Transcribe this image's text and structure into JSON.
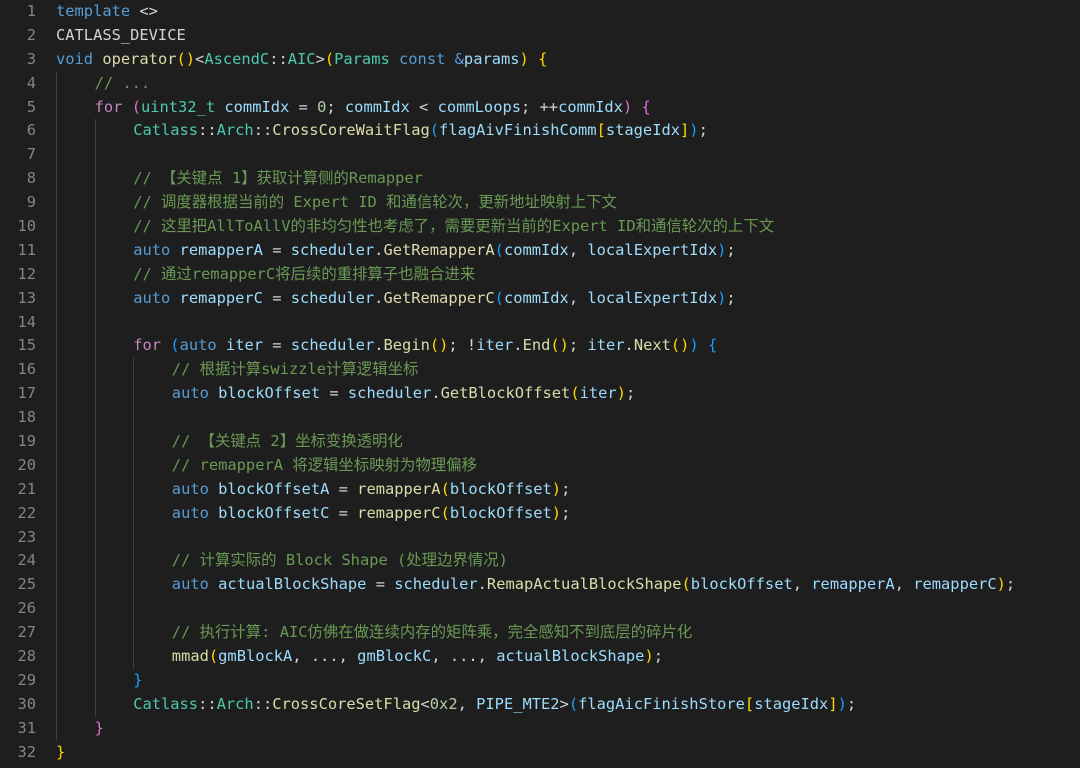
{
  "editor": {
    "theme_colors": {
      "background": "#1e1e1e",
      "line_number": "#858585",
      "keyword": "#569cd6",
      "control": "#c586c0",
      "type": "#4ec9b0",
      "function": "#dcdcaa",
      "variable": "#9cdcfe",
      "number": "#b5cea8",
      "comment": "#6a9955",
      "text": "#d4d4d4",
      "bracket_1": "#ffd700",
      "bracket_2": "#da70d6",
      "bracket_3": "#179fff"
    },
    "lines": [
      {
        "n": "1",
        "indent": 0,
        "tokens": [
          [
            "kw",
            "template"
          ],
          [
            "pl",
            " <>"
          ]
        ]
      },
      {
        "n": "2",
        "indent": 0,
        "tokens": [
          [
            "pl",
            "CATLASS_DEVICE"
          ]
        ]
      },
      {
        "n": "3",
        "indent": 0,
        "tokens": [
          [
            "kw",
            "void"
          ],
          [
            "pl",
            " "
          ],
          [
            "fn",
            "operator"
          ],
          [
            "b1",
            "()"
          ],
          [
            "pl",
            "<"
          ],
          [
            "typ",
            "AscendC"
          ],
          [
            "pl",
            "::"
          ],
          [
            "typ",
            "AIC"
          ],
          [
            "pl",
            ">"
          ],
          [
            "b1",
            "("
          ],
          [
            "typ",
            "Params"
          ],
          [
            "pl",
            " "
          ],
          [
            "kw",
            "const"
          ],
          [
            "pl",
            " "
          ],
          [
            "kw",
            "&"
          ],
          [
            "var",
            "params"
          ],
          [
            "b1",
            ")"
          ],
          [
            "pl",
            " "
          ],
          [
            "b1",
            "{"
          ]
        ]
      },
      {
        "n": "4",
        "indent": 1,
        "tokens": [
          [
            "cmt",
            "// ..."
          ]
        ]
      },
      {
        "n": "5",
        "indent": 1,
        "tokens": [
          [
            "ctl",
            "for"
          ],
          [
            "pl",
            " "
          ],
          [
            "b2",
            "("
          ],
          [
            "typ",
            "uint32_t"
          ],
          [
            "pl",
            " "
          ],
          [
            "var",
            "commIdx"
          ],
          [
            "pl",
            " = "
          ],
          [
            "num",
            "0"
          ],
          [
            "pl",
            "; "
          ],
          [
            "var",
            "commIdx"
          ],
          [
            "pl",
            " < "
          ],
          [
            "var",
            "commLoops"
          ],
          [
            "pl",
            "; ++"
          ],
          [
            "var",
            "commIdx"
          ],
          [
            "b2",
            ")"
          ],
          [
            "pl",
            " "
          ],
          [
            "b2",
            "{"
          ]
        ]
      },
      {
        "n": "6",
        "indent": 2,
        "tokens": [
          [
            "typ",
            "Catlass"
          ],
          [
            "pl",
            "::"
          ],
          [
            "typ",
            "Arch"
          ],
          [
            "pl",
            "::"
          ],
          [
            "fn",
            "CrossCoreWaitFlag"
          ],
          [
            "b3",
            "("
          ],
          [
            "var",
            "flagAivFinishComm"
          ],
          [
            "b1",
            "["
          ],
          [
            "var",
            "stageIdx"
          ],
          [
            "b1",
            "]"
          ],
          [
            "b3",
            ")"
          ],
          [
            "pl",
            ";"
          ]
        ]
      },
      {
        "n": "7",
        "indent": 2,
        "tokens": []
      },
      {
        "n": "8",
        "indent": 2,
        "tokens": [
          [
            "cmt",
            "// 【关键点 1】获取计算侧的Remapper"
          ]
        ]
      },
      {
        "n": "9",
        "indent": 2,
        "tokens": [
          [
            "cmt",
            "// 调度器根据当前的 Expert ID 和通信轮次，更新地址映射上下文"
          ]
        ]
      },
      {
        "n": "10",
        "indent": 2,
        "tokens": [
          [
            "cmt",
            "// 这里把AllToAllV的非均匀性也考虑了，需要更新当前的Expert ID和通信轮次的上下文"
          ]
        ]
      },
      {
        "n": "11",
        "indent": 2,
        "tokens": [
          [
            "kw",
            "auto"
          ],
          [
            "pl",
            " "
          ],
          [
            "var",
            "remapperA"
          ],
          [
            "pl",
            " = "
          ],
          [
            "var",
            "scheduler"
          ],
          [
            "pl",
            "."
          ],
          [
            "fn",
            "GetRemapperA"
          ],
          [
            "b3",
            "("
          ],
          [
            "var",
            "commIdx"
          ],
          [
            "pl",
            ", "
          ],
          [
            "var",
            "localExpertIdx"
          ],
          [
            "b3",
            ")"
          ],
          [
            "pl",
            ";"
          ]
        ]
      },
      {
        "n": "12",
        "indent": 2,
        "tokens": [
          [
            "cmt",
            "// 通过remapperC将后续的重排算子也融合进来"
          ]
        ]
      },
      {
        "n": "13",
        "indent": 2,
        "tokens": [
          [
            "kw",
            "auto"
          ],
          [
            "pl",
            " "
          ],
          [
            "var",
            "remapperC"
          ],
          [
            "pl",
            " = "
          ],
          [
            "var",
            "scheduler"
          ],
          [
            "pl",
            "."
          ],
          [
            "fn",
            "GetRemapperC"
          ],
          [
            "b3",
            "("
          ],
          [
            "var",
            "commIdx"
          ],
          [
            "pl",
            ", "
          ],
          [
            "var",
            "localExpertIdx"
          ],
          [
            "b3",
            ")"
          ],
          [
            "pl",
            ";"
          ]
        ]
      },
      {
        "n": "14",
        "indent": 2,
        "tokens": []
      },
      {
        "n": "15",
        "indent": 2,
        "tokens": [
          [
            "ctl",
            "for"
          ],
          [
            "pl",
            " "
          ],
          [
            "b3",
            "("
          ],
          [
            "kw",
            "auto"
          ],
          [
            "pl",
            " "
          ],
          [
            "var",
            "iter"
          ],
          [
            "pl",
            " = "
          ],
          [
            "var",
            "scheduler"
          ],
          [
            "pl",
            "."
          ],
          [
            "fn",
            "Begin"
          ],
          [
            "b1",
            "()"
          ],
          [
            "pl",
            "; !"
          ],
          [
            "var",
            "iter"
          ],
          [
            "pl",
            "."
          ],
          [
            "fn",
            "End"
          ],
          [
            "b1",
            "()"
          ],
          [
            "pl",
            "; "
          ],
          [
            "var",
            "iter"
          ],
          [
            "pl",
            "."
          ],
          [
            "fn",
            "Next"
          ],
          [
            "b1",
            "()"
          ],
          [
            "b3",
            ")"
          ],
          [
            "pl",
            " "
          ],
          [
            "b3",
            "{"
          ]
        ]
      },
      {
        "n": "16",
        "indent": 3,
        "tokens": [
          [
            "cmt",
            "// 根据计算swizzle计算逻辑坐标"
          ]
        ]
      },
      {
        "n": "17",
        "indent": 3,
        "tokens": [
          [
            "kw",
            "auto"
          ],
          [
            "pl",
            " "
          ],
          [
            "var",
            "blockOffset"
          ],
          [
            "pl",
            " = "
          ],
          [
            "var",
            "scheduler"
          ],
          [
            "pl",
            "."
          ],
          [
            "fn",
            "GetBlockOffset"
          ],
          [
            "b1",
            "("
          ],
          [
            "var",
            "iter"
          ],
          [
            "b1",
            ")"
          ],
          [
            "pl",
            ";"
          ]
        ]
      },
      {
        "n": "18",
        "indent": 3,
        "tokens": []
      },
      {
        "n": "19",
        "indent": 3,
        "tokens": [
          [
            "cmt",
            "// 【关键点 2】坐标变换透明化"
          ]
        ]
      },
      {
        "n": "20",
        "indent": 3,
        "tokens": [
          [
            "cmt",
            "// remapperA 将逻辑坐标映射为物理偏移"
          ]
        ]
      },
      {
        "n": "21",
        "indent": 3,
        "tokens": [
          [
            "kw",
            "auto"
          ],
          [
            "pl",
            " "
          ],
          [
            "var",
            "blockOffsetA"
          ],
          [
            "pl",
            " = "
          ],
          [
            "fn",
            "remapperA"
          ],
          [
            "b1",
            "("
          ],
          [
            "var",
            "blockOffset"
          ],
          [
            "b1",
            ")"
          ],
          [
            "pl",
            ";"
          ]
        ]
      },
      {
        "n": "22",
        "indent": 3,
        "tokens": [
          [
            "kw",
            "auto"
          ],
          [
            "pl",
            " "
          ],
          [
            "var",
            "blockOffsetC"
          ],
          [
            "pl",
            " = "
          ],
          [
            "fn",
            "remapperC"
          ],
          [
            "b1",
            "("
          ],
          [
            "var",
            "blockOffset"
          ],
          [
            "b1",
            ")"
          ],
          [
            "pl",
            ";"
          ]
        ]
      },
      {
        "n": "23",
        "indent": 3,
        "tokens": []
      },
      {
        "n": "24",
        "indent": 3,
        "tokens": [
          [
            "cmt",
            "// 计算实际的 Block Shape (处理边界情况)"
          ]
        ]
      },
      {
        "n": "25",
        "indent": 3,
        "tokens": [
          [
            "kw",
            "auto"
          ],
          [
            "pl",
            " "
          ],
          [
            "var",
            "actualBlockShape"
          ],
          [
            "pl",
            " = "
          ],
          [
            "var",
            "scheduler"
          ],
          [
            "pl",
            "."
          ],
          [
            "fn",
            "RemapActualBlockShape"
          ],
          [
            "b1",
            "("
          ],
          [
            "var",
            "blockOffset"
          ],
          [
            "pl",
            ", "
          ],
          [
            "var",
            "remapperA"
          ],
          [
            "pl",
            ", "
          ],
          [
            "var",
            "remapperC"
          ],
          [
            "b1",
            ")"
          ],
          [
            "pl",
            ";"
          ]
        ]
      },
      {
        "n": "26",
        "indent": 3,
        "tokens": []
      },
      {
        "n": "27",
        "indent": 3,
        "tokens": [
          [
            "cmt",
            "// 执行计算: AIC仿佛在做连续内存的矩阵乘，完全感知不到底层的碎片化"
          ]
        ]
      },
      {
        "n": "28",
        "indent": 3,
        "tokens": [
          [
            "fn",
            "mmad"
          ],
          [
            "b1",
            "("
          ],
          [
            "var",
            "gmBlockA"
          ],
          [
            "pl",
            ", ..., "
          ],
          [
            "var",
            "gmBlockC"
          ],
          [
            "pl",
            ", ..., "
          ],
          [
            "var",
            "actualBlockShape"
          ],
          [
            "b1",
            ")"
          ],
          [
            "pl",
            ";"
          ]
        ]
      },
      {
        "n": "29",
        "indent": 2,
        "tokens": [
          [
            "b3",
            "}"
          ]
        ]
      },
      {
        "n": "30",
        "indent": 2,
        "tokens": [
          [
            "typ",
            "Catlass"
          ],
          [
            "pl",
            "::"
          ],
          [
            "typ",
            "Arch"
          ],
          [
            "pl",
            "::"
          ],
          [
            "fn",
            "CrossCoreSetFlag"
          ],
          [
            "pl",
            "<"
          ],
          [
            "num",
            "0x2"
          ],
          [
            "pl",
            ", "
          ],
          [
            "var",
            "PIPE_MTE2"
          ],
          [
            "pl",
            ">"
          ],
          [
            "b3",
            "("
          ],
          [
            "var",
            "flagAicFinishStore"
          ],
          [
            "b1",
            "["
          ],
          [
            "var",
            "stageIdx"
          ],
          [
            "b1",
            "]"
          ],
          [
            "b3",
            ")"
          ],
          [
            "pl",
            ";"
          ]
        ]
      },
      {
        "n": "31",
        "indent": 1,
        "tokens": [
          [
            "b2",
            "}"
          ]
        ]
      },
      {
        "n": "32",
        "indent": 0,
        "tokens": [
          [
            "b1",
            "}"
          ]
        ]
      }
    ]
  }
}
